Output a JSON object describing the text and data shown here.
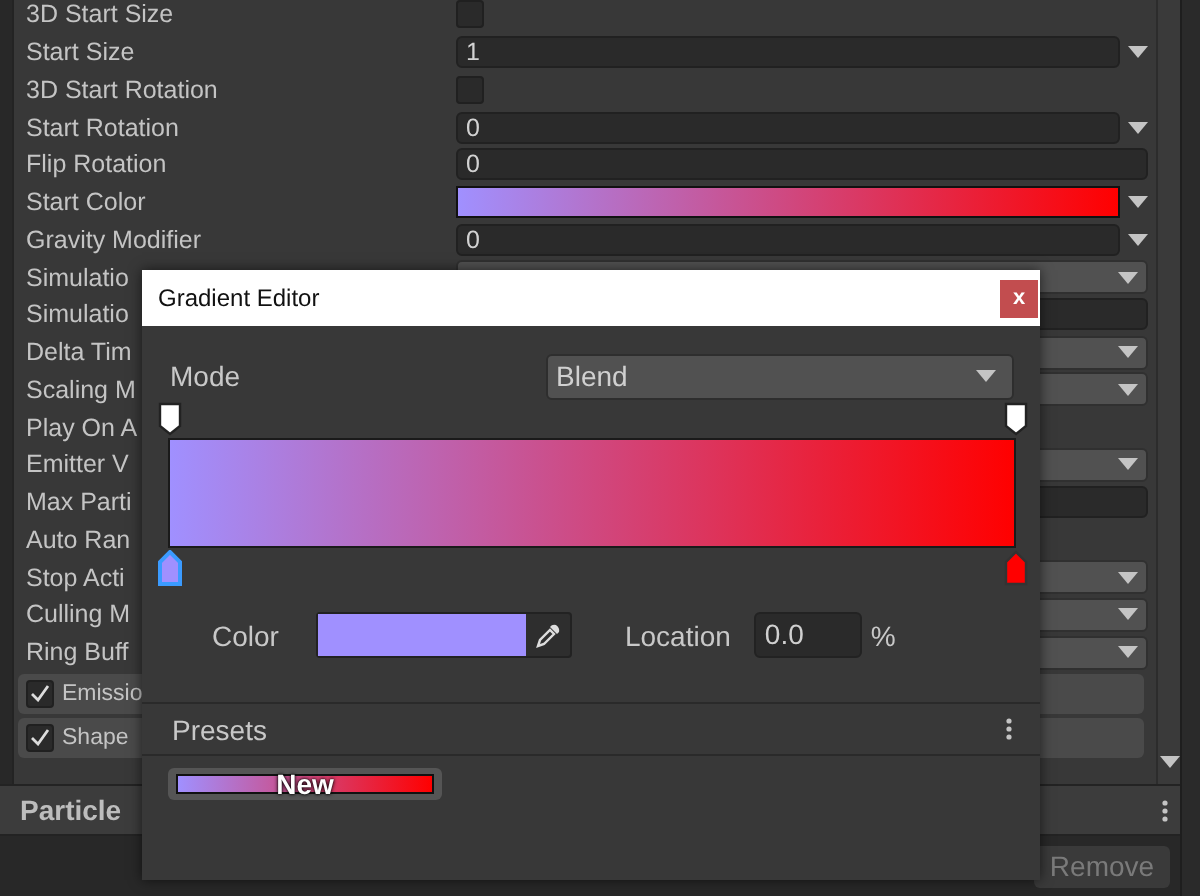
{
  "inspector": {
    "rows": [
      {
        "label": "3D Start Size",
        "kind": "checkbox",
        "checked": false
      },
      {
        "label": "Start Size",
        "kind": "field",
        "value": "1",
        "dropdown": true
      },
      {
        "label": "3D Start Rotation",
        "kind": "checkbox",
        "checked": false
      },
      {
        "label": "Start Rotation",
        "kind": "field",
        "value": "0",
        "dropdown": true
      },
      {
        "label": "Flip Rotation",
        "kind": "field",
        "value": "0",
        "dropdown": false
      },
      {
        "label": "Start Color",
        "kind": "gradient",
        "dropdown": true
      },
      {
        "label": "Gravity Modifier",
        "kind": "field",
        "value": "0",
        "dropdown": true
      },
      {
        "label": "Simulatio",
        "kind": "popup"
      },
      {
        "label": "Simulatio",
        "kind": "field",
        "dropdown": false
      },
      {
        "label": "Delta Tim",
        "kind": "popup"
      },
      {
        "label": "Scaling M",
        "kind": "popup"
      },
      {
        "label": "Play On A",
        "kind": "plain"
      },
      {
        "label": "Emitter V",
        "kind": "popup"
      },
      {
        "label": "Max Parti",
        "kind": "field",
        "dropdown": false
      },
      {
        "label": "Auto Ran",
        "kind": "plain"
      },
      {
        "label": "Stop Acti",
        "kind": "popup"
      },
      {
        "label": "Culling M",
        "kind": "popup"
      },
      {
        "label": "Ring Buff",
        "kind": "popup"
      }
    ],
    "modules": [
      {
        "label": "Emissio",
        "checked": true
      },
      {
        "label": "Shape",
        "checked": true
      }
    ]
  },
  "renderer": {
    "title": "Particle",
    "button": "Remove"
  },
  "gradient_editor": {
    "title": "Gradient Editor",
    "close": "x",
    "mode": {
      "label": "Mode",
      "value": "Blend"
    },
    "alpha_keys": [
      {
        "color": "#ffffff",
        "selected": false
      },
      {
        "color": "#ffffff",
        "selected": false
      }
    ],
    "color_keys": [
      {
        "color": "#a090ff",
        "selected": true
      },
      {
        "color": "#ff0000",
        "selected": false
      }
    ],
    "color_field": {
      "label": "Color",
      "color": "#a090ff"
    },
    "location": {
      "label": "Location",
      "value": "0.0",
      "unit": "%"
    },
    "presets": {
      "title": "Presets",
      "items": [
        {
          "label": "New"
        }
      ]
    }
  }
}
